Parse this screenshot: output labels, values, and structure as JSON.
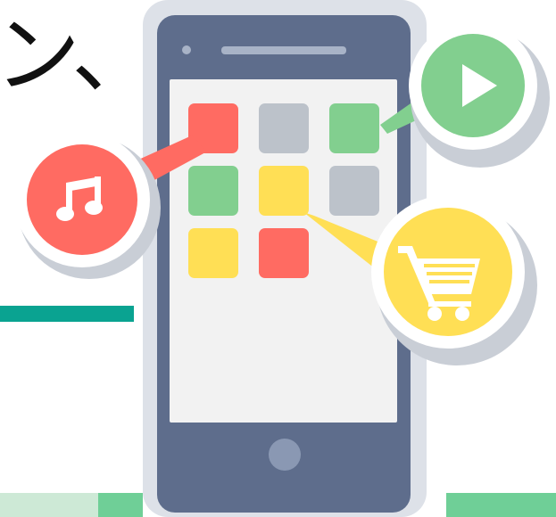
{
  "heading_fragment": "ン、",
  "colors": {
    "background": "#ffffff",
    "accent_line": "#0aa391",
    "band_light": "#cde9d6",
    "band_green": "#6fcf97",
    "phone_body": "#5e6d8c",
    "phone_screen": "#f2f2f2",
    "phone_speaker": "#a8b3c7",
    "phone_home_button": "#8a98b3",
    "phone_outline": "#dde1e8",
    "app_red": "#ff6b62",
    "app_gray": "#bcc2ca",
    "app_green": "#82cf8f",
    "app_yellow": "#ffdf55",
    "bubble_shadow": "#c9ced6"
  },
  "app_grid": [
    [
      "red",
      "gray",
      "green"
    ],
    [
      "green",
      "yellow",
      "gray"
    ],
    [
      "yellow",
      "red",
      null
    ]
  ],
  "bubbles": [
    {
      "name": "music",
      "icon": "music-note-icon",
      "color": "#ff6b62"
    },
    {
      "name": "play",
      "icon": "play-icon",
      "color": "#82cf8f"
    },
    {
      "name": "shopping",
      "icon": "shopping-cart-icon",
      "color": "#ffdf55"
    }
  ]
}
